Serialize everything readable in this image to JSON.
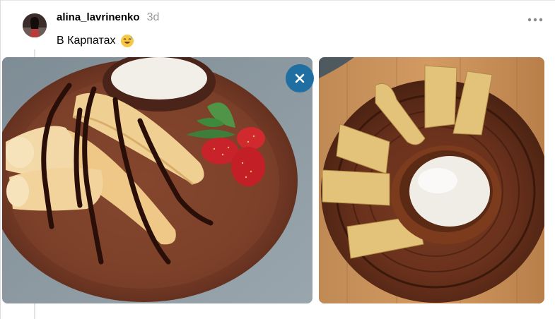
{
  "post": {
    "username": "alina_lavrinenko",
    "time": "3d",
    "caption": "В Карпатах",
    "caption_emoji": "😅",
    "avatar": "avatar",
    "more_icon": "more-horizontal-icon"
  },
  "media": {
    "images": [
      {
        "description_icon": "photo",
        "name": "pancakes-chocolate-photo"
      },
      {
        "description_icon": "photo",
        "name": "pancakes-sour-cream-photo"
      }
    ],
    "close_icon": "close-icon"
  },
  "colors": {
    "close_button": "#1f6fa3",
    "username": "#000000",
    "time": "#999999"
  }
}
